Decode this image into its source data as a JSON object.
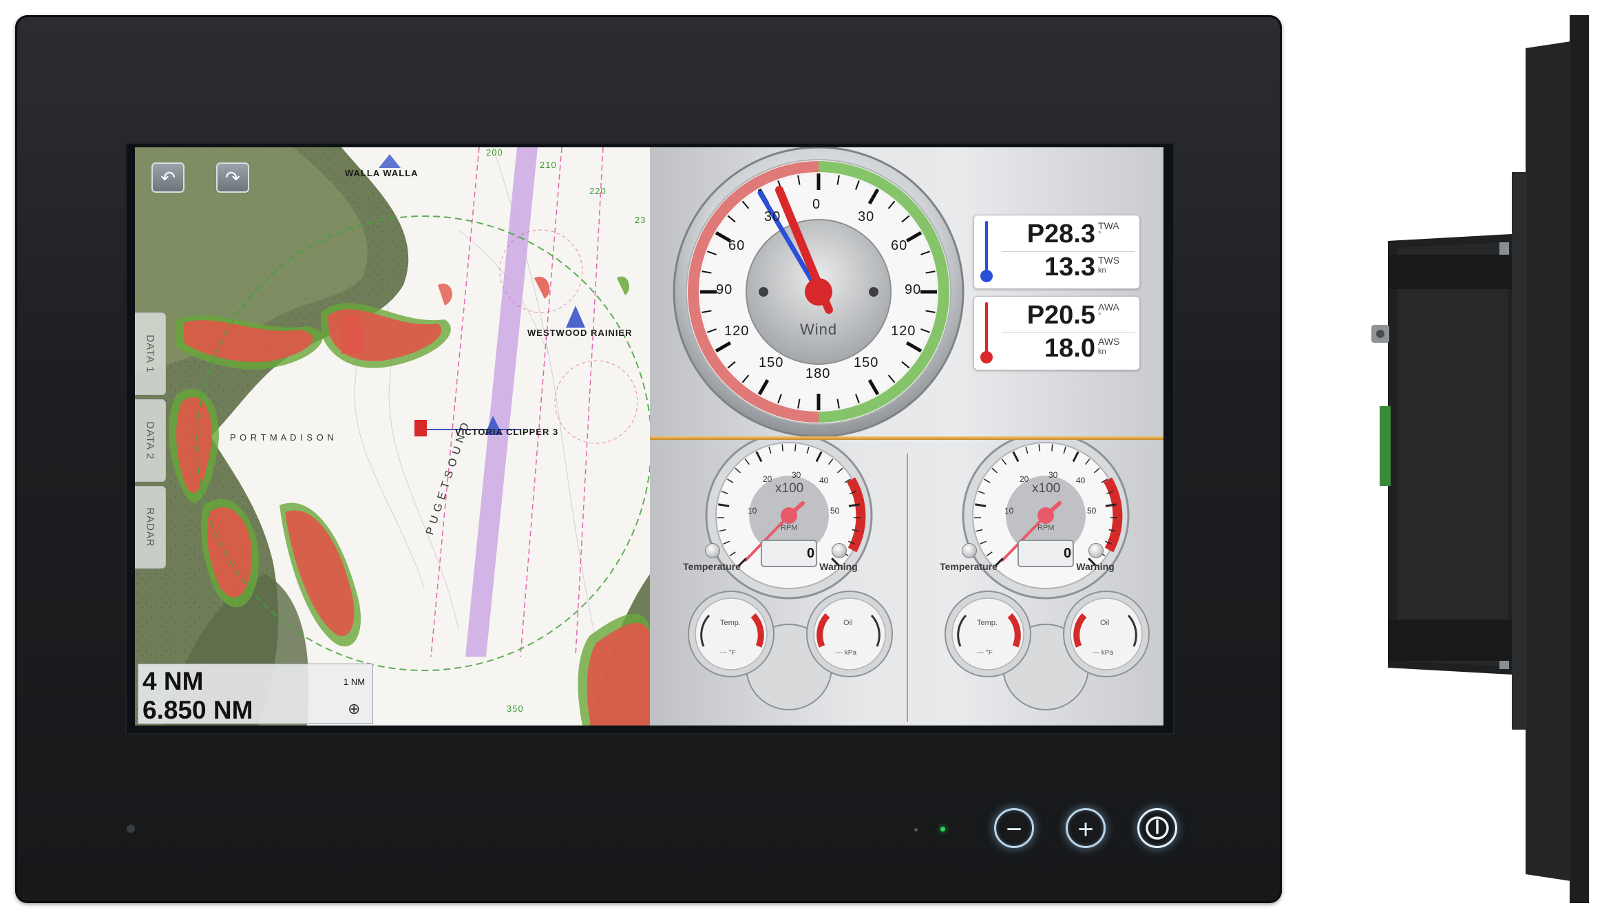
{
  "chart": {
    "range": "4 NM",
    "range_unit": "1 NM",
    "distance": "6.850 NM",
    "side_tabs": [
      "DATA 1",
      "DATA 2",
      "RADAR"
    ],
    "labels": {
      "walla_walla": "WALLA WALLA",
      "westwood": "WESTWOOD RAINIER",
      "victoria": "VICTORIA CLIPPER 3",
      "port_madison": "P O R T   M A D I S O N",
      "puget_sound": "P U G E T   S O U N D"
    },
    "compass_ticks": [
      "200",
      "210",
      "220",
      "23",
      "350"
    ]
  },
  "wind": {
    "title": "Wind",
    "scale": [
      "0",
      "30",
      "60",
      "90",
      "120",
      "150",
      "180",
      "150",
      "120",
      "90",
      "60",
      "30"
    ],
    "twa_value": "P28.3",
    "twa_label": "TWA",
    "twa_unit": "°",
    "tws_value": "13.3",
    "tws_label": "TWS",
    "tws_unit": "kn",
    "awa_value": "P20.5",
    "awa_label": "AWA",
    "awa_unit": "°",
    "aws_value": "18.0",
    "aws_label": "AWS",
    "aws_unit": "kn",
    "colors": {
      "true": "#2b4fd8",
      "apparent": "#d8282b",
      "port": "#e07a78",
      "starboard": "#86c46a"
    }
  },
  "engines": [
    {
      "rpm_multiplier": "x100",
      "rpm_label": "RPM",
      "rpm_value": "0",
      "rpm_scale": [
        "10",
        "20",
        "30",
        "40",
        "50"
      ],
      "temp_label": "Temperature",
      "warn_label": "Warning",
      "temp_gauge": "Temp.",
      "temp_unit": "--- °F",
      "oil_gauge": "Oil",
      "oil_unit": "--- kPa"
    },
    {
      "rpm_multiplier": "x100",
      "rpm_label": "RPM",
      "rpm_value": "0",
      "rpm_scale": [
        "10",
        "20",
        "30",
        "40",
        "50"
      ],
      "temp_label": "Temperature",
      "warn_label": "Warning",
      "temp_gauge": "Temp.",
      "temp_unit": "--- °F",
      "oil_gauge": "Oil",
      "oil_unit": "--- kPa"
    }
  ],
  "hardware": {
    "minus": "−",
    "plus": "+",
    "power_icon": "power-icon",
    "status_led_color": "#29d85a"
  }
}
